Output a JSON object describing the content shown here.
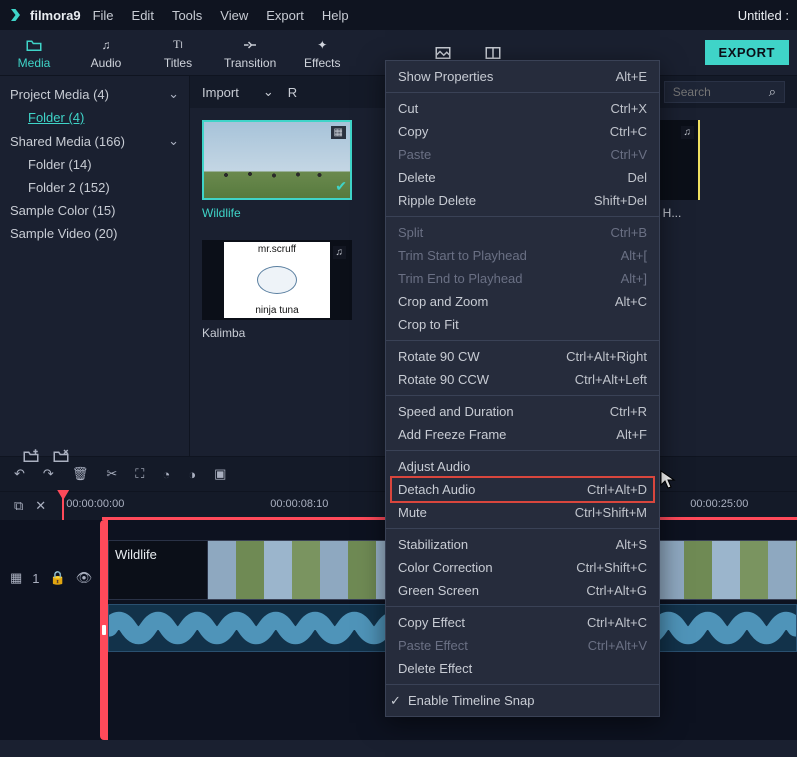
{
  "titlebar": {
    "app_name": "filmora9",
    "menu": [
      "File",
      "Edit",
      "Tools",
      "View",
      "Export",
      "Help"
    ],
    "project": "Untitled :"
  },
  "toolbar": {
    "tabs": [
      {
        "id": "media",
        "label": "Media"
      },
      {
        "id": "audio",
        "label": "Audio"
      },
      {
        "id": "titles",
        "label": "Titles"
      },
      {
        "id": "transition",
        "label": "Transition"
      },
      {
        "id": "effects",
        "label": "Effects"
      }
    ],
    "export": "EXPORT"
  },
  "sidebar": {
    "items": [
      {
        "label": "Project Media (4)",
        "expandable": true
      },
      {
        "label": "Folder (4)",
        "link": true,
        "indent": true
      },
      {
        "label": "Shared Media (166)",
        "expandable": true
      },
      {
        "label": "Folder (14)",
        "indent": true
      },
      {
        "label": "Folder 2 (152)",
        "indent": true
      },
      {
        "label": "Sample Color (15)"
      },
      {
        "label": "Sample Video (20)"
      }
    ]
  },
  "content": {
    "import": "Import",
    "record": "R",
    "search_placeholder": "Search",
    "thumbs": [
      {
        "label": "Wildlife",
        "selected": true,
        "kind": "video"
      },
      {
        "label": "xen H...",
        "kind": "audio"
      },
      {
        "label": "Kalimba",
        "kind": "audio",
        "art": {
          "top": "mr.scruff",
          "bottom": "ninja tuna"
        }
      }
    ]
  },
  "context_menu": {
    "groups": [
      [
        {
          "label": "Show Properties",
          "shortcut": "Alt+E"
        }
      ],
      [
        {
          "label": "Cut",
          "shortcut": "Ctrl+X"
        },
        {
          "label": "Copy",
          "shortcut": "Ctrl+C"
        },
        {
          "label": "Paste",
          "shortcut": "Ctrl+V",
          "disabled": true
        },
        {
          "label": "Delete",
          "shortcut": "Del"
        },
        {
          "label": "Ripple Delete",
          "shortcut": "Shift+Del"
        }
      ],
      [
        {
          "label": "Split",
          "shortcut": "Ctrl+B",
          "disabled": true
        },
        {
          "label": "Trim Start to Playhead",
          "shortcut": "Alt+[",
          "disabled": true
        },
        {
          "label": "Trim End to Playhead",
          "shortcut": "Alt+]",
          "disabled": true
        },
        {
          "label": "Crop and Zoom",
          "shortcut": "Alt+C"
        },
        {
          "label": "Crop to Fit"
        }
      ],
      [
        {
          "label": "Rotate 90 CW",
          "shortcut": "Ctrl+Alt+Right"
        },
        {
          "label": "Rotate 90 CCW",
          "shortcut": "Ctrl+Alt+Left"
        }
      ],
      [
        {
          "label": "Speed and Duration",
          "shortcut": "Ctrl+R"
        },
        {
          "label": "Add Freeze Frame",
          "shortcut": "Alt+F"
        }
      ],
      [
        {
          "label": "Adjust Audio"
        },
        {
          "label": "Detach Audio",
          "shortcut": "Ctrl+Alt+D",
          "highlight": true
        },
        {
          "label": "Mute",
          "shortcut": "Ctrl+Shift+M"
        }
      ],
      [
        {
          "label": "Stabilization",
          "shortcut": "Alt+S"
        },
        {
          "label": "Color Correction",
          "shortcut": "Ctrl+Shift+C"
        },
        {
          "label": "Green Screen",
          "shortcut": "Ctrl+Alt+G"
        }
      ],
      [
        {
          "label": "Copy Effect",
          "shortcut": "Ctrl+Alt+C"
        },
        {
          "label": "Paste Effect",
          "shortcut": "Ctrl+Alt+V",
          "disabled": true
        },
        {
          "label": "Delete Effect"
        }
      ],
      [
        {
          "label": "Enable Timeline Snap",
          "checked": true
        }
      ]
    ]
  },
  "timeline": {
    "ruler": [
      "00:00:00:00",
      "00:00:08:10",
      "00:00:25:00"
    ],
    "clip_label": "Wildlife",
    "track_number": "1"
  }
}
